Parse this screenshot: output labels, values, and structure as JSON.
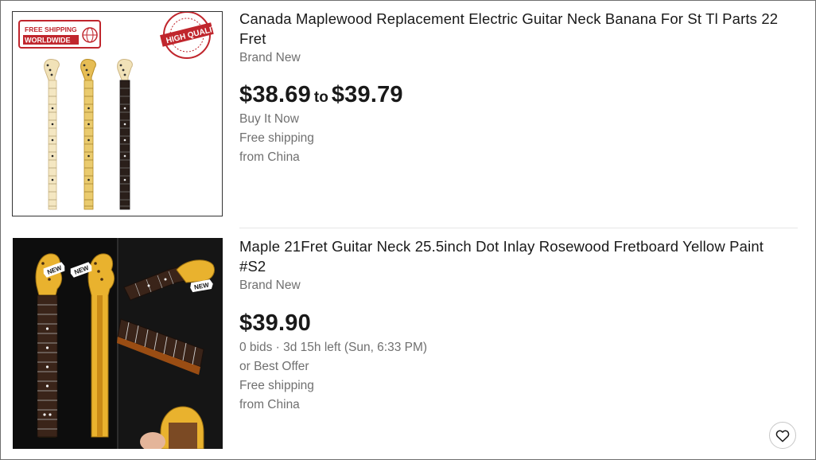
{
  "listings": [
    {
      "title": "Canada Maplewood Replacement Electric Guitar Neck Banana For St Tl Parts 22 Fret",
      "condition": "Brand New",
      "price_low": "$38.69",
      "price_sep": "to",
      "price_high": "$39.79",
      "buying_format": "Buy It Now",
      "shipping": "Free shipping",
      "location": "from China",
      "image": {
        "badge_left_line1": "FREE SHIPPING",
        "badge_left_line2": "WORLDWIDE",
        "badge_right": "HIGH QUALITY",
        "badge_right_ring_top": "HIGH QUALITY",
        "badge_right_ring_bottom": "HIGH QUALITY"
      }
    },
    {
      "title": "Maple 21Fret Guitar Neck 25.5inch Dot Inlay Rosewood Fretboard Yellow Paint #S2",
      "condition": "Brand New",
      "price": "$39.90",
      "bid_info": "0 bids · 3d 15h left (Sun, 6:33 PM)",
      "offer": "or Best Offer",
      "shipping": "Free shipping",
      "location": "from China",
      "image": {
        "tag1": "NEW",
        "tag2": "NEW",
        "tag3": "NEW"
      }
    }
  ],
  "icons": {
    "watch": "heart-icon"
  },
  "colors": {
    "text": "#191919",
    "muted": "#707070",
    "badge_red": "#c0262d",
    "maple": "#f1e2b8",
    "yellow_neck": "#e9b22e",
    "rosewood": "#2a1a14"
  }
}
